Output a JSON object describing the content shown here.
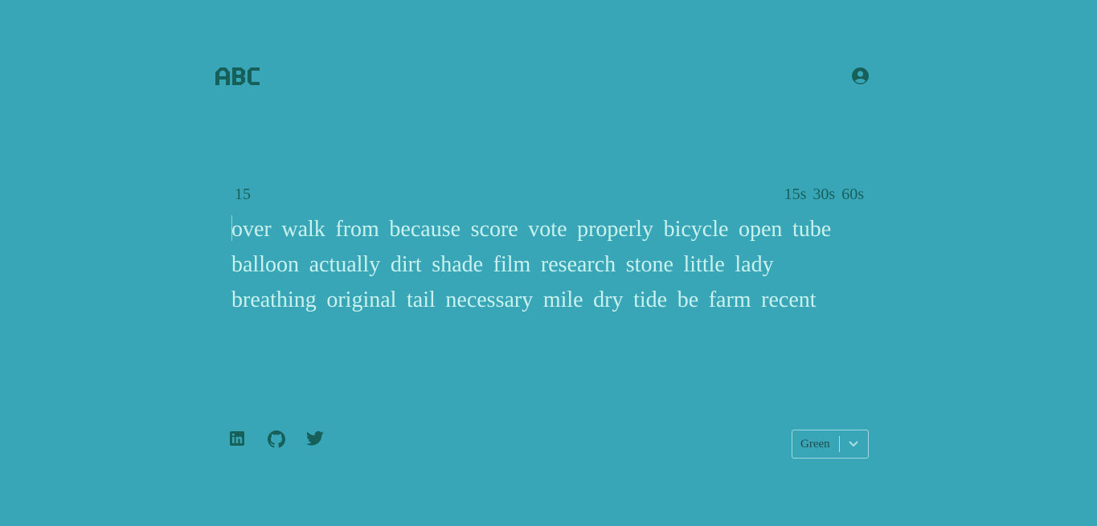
{
  "header": {
    "logo_text": "ABC",
    "account_icon": "user-circle-icon"
  },
  "test": {
    "counter": "15",
    "durations": [
      "15s",
      "30s",
      "60s"
    ],
    "lines": [
      [
        "over",
        "walk",
        "from",
        "because",
        "score",
        "vote",
        "properly",
        "bicycle",
        "open",
        "tube"
      ],
      [
        "balloon",
        "actually",
        "dirt",
        "shade",
        "film",
        "research",
        "stone",
        "little",
        "lady"
      ],
      [
        "breathing",
        "original",
        "tail",
        "necessary",
        "mile",
        "dry",
        "tide",
        "be",
        "farm",
        "recent"
      ]
    ]
  },
  "footer": {
    "socials": [
      "linkedin-icon",
      "github-icon",
      "twitter-icon"
    ],
    "theme": {
      "selected": "Green"
    }
  },
  "colors": {
    "background": "#39a6b8",
    "accent": "#17605a",
    "text": "#c9f2ee"
  }
}
